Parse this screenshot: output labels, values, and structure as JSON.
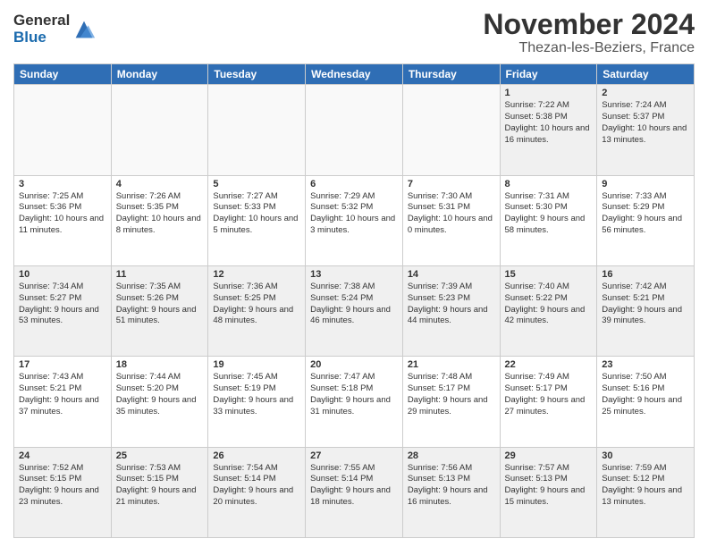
{
  "logo": {
    "general": "General",
    "blue": "Blue"
  },
  "title": "November 2024",
  "location": "Thezan-les-Beziers, France",
  "days_of_week": [
    "Sunday",
    "Monday",
    "Tuesday",
    "Wednesday",
    "Thursday",
    "Friday",
    "Saturday"
  ],
  "weeks": [
    [
      {
        "day": "",
        "info": ""
      },
      {
        "day": "",
        "info": ""
      },
      {
        "day": "",
        "info": ""
      },
      {
        "day": "",
        "info": ""
      },
      {
        "day": "",
        "info": ""
      },
      {
        "day": "1",
        "info": "Sunrise: 7:22 AM\nSunset: 5:38 PM\nDaylight: 10 hours and 16 minutes."
      },
      {
        "day": "2",
        "info": "Sunrise: 7:24 AM\nSunset: 5:37 PM\nDaylight: 10 hours and 13 minutes."
      }
    ],
    [
      {
        "day": "3",
        "info": "Sunrise: 7:25 AM\nSunset: 5:36 PM\nDaylight: 10 hours and 11 minutes."
      },
      {
        "day": "4",
        "info": "Sunrise: 7:26 AM\nSunset: 5:35 PM\nDaylight: 10 hours and 8 minutes."
      },
      {
        "day": "5",
        "info": "Sunrise: 7:27 AM\nSunset: 5:33 PM\nDaylight: 10 hours and 5 minutes."
      },
      {
        "day": "6",
        "info": "Sunrise: 7:29 AM\nSunset: 5:32 PM\nDaylight: 10 hours and 3 minutes."
      },
      {
        "day": "7",
        "info": "Sunrise: 7:30 AM\nSunset: 5:31 PM\nDaylight: 10 hours and 0 minutes."
      },
      {
        "day": "8",
        "info": "Sunrise: 7:31 AM\nSunset: 5:30 PM\nDaylight: 9 hours and 58 minutes."
      },
      {
        "day": "9",
        "info": "Sunrise: 7:33 AM\nSunset: 5:29 PM\nDaylight: 9 hours and 56 minutes."
      }
    ],
    [
      {
        "day": "10",
        "info": "Sunrise: 7:34 AM\nSunset: 5:27 PM\nDaylight: 9 hours and 53 minutes."
      },
      {
        "day": "11",
        "info": "Sunrise: 7:35 AM\nSunset: 5:26 PM\nDaylight: 9 hours and 51 minutes."
      },
      {
        "day": "12",
        "info": "Sunrise: 7:36 AM\nSunset: 5:25 PM\nDaylight: 9 hours and 48 minutes."
      },
      {
        "day": "13",
        "info": "Sunrise: 7:38 AM\nSunset: 5:24 PM\nDaylight: 9 hours and 46 minutes."
      },
      {
        "day": "14",
        "info": "Sunrise: 7:39 AM\nSunset: 5:23 PM\nDaylight: 9 hours and 44 minutes."
      },
      {
        "day": "15",
        "info": "Sunrise: 7:40 AM\nSunset: 5:22 PM\nDaylight: 9 hours and 42 minutes."
      },
      {
        "day": "16",
        "info": "Sunrise: 7:42 AM\nSunset: 5:21 PM\nDaylight: 9 hours and 39 minutes."
      }
    ],
    [
      {
        "day": "17",
        "info": "Sunrise: 7:43 AM\nSunset: 5:21 PM\nDaylight: 9 hours and 37 minutes."
      },
      {
        "day": "18",
        "info": "Sunrise: 7:44 AM\nSunset: 5:20 PM\nDaylight: 9 hours and 35 minutes."
      },
      {
        "day": "19",
        "info": "Sunrise: 7:45 AM\nSunset: 5:19 PM\nDaylight: 9 hours and 33 minutes."
      },
      {
        "day": "20",
        "info": "Sunrise: 7:47 AM\nSunset: 5:18 PM\nDaylight: 9 hours and 31 minutes."
      },
      {
        "day": "21",
        "info": "Sunrise: 7:48 AM\nSunset: 5:17 PM\nDaylight: 9 hours and 29 minutes."
      },
      {
        "day": "22",
        "info": "Sunrise: 7:49 AM\nSunset: 5:17 PM\nDaylight: 9 hours and 27 minutes."
      },
      {
        "day": "23",
        "info": "Sunrise: 7:50 AM\nSunset: 5:16 PM\nDaylight: 9 hours and 25 minutes."
      }
    ],
    [
      {
        "day": "24",
        "info": "Sunrise: 7:52 AM\nSunset: 5:15 PM\nDaylight: 9 hours and 23 minutes."
      },
      {
        "day": "25",
        "info": "Sunrise: 7:53 AM\nSunset: 5:15 PM\nDaylight: 9 hours and 21 minutes."
      },
      {
        "day": "26",
        "info": "Sunrise: 7:54 AM\nSunset: 5:14 PM\nDaylight: 9 hours and 20 minutes."
      },
      {
        "day": "27",
        "info": "Sunrise: 7:55 AM\nSunset: 5:14 PM\nDaylight: 9 hours and 18 minutes."
      },
      {
        "day": "28",
        "info": "Sunrise: 7:56 AM\nSunset: 5:13 PM\nDaylight: 9 hours and 16 minutes."
      },
      {
        "day": "29",
        "info": "Sunrise: 7:57 AM\nSunset: 5:13 PM\nDaylight: 9 hours and 15 minutes."
      },
      {
        "day": "30",
        "info": "Sunrise: 7:59 AM\nSunset: 5:12 PM\nDaylight: 9 hours and 13 minutes."
      }
    ]
  ]
}
